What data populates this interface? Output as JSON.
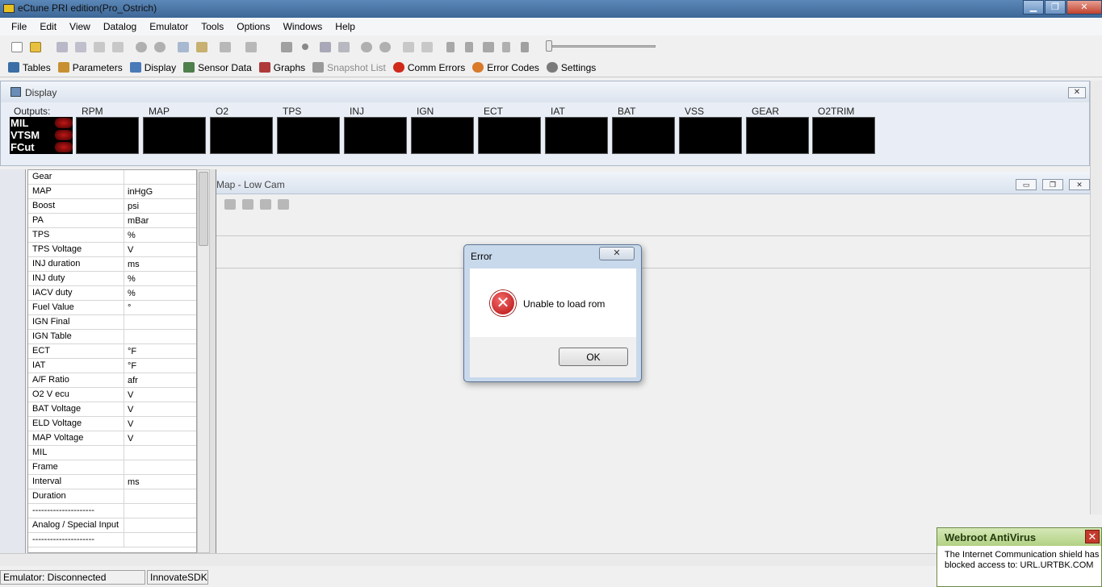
{
  "window": {
    "title": "eCtune PRI edition(Pro_Ostrich)",
    "minimize": "▁",
    "maximize": "❐",
    "close": "✕"
  },
  "menu": [
    "File",
    "Edit",
    "View",
    "Datalog",
    "Emulator",
    "Tools",
    "Options",
    "Windows",
    "Help"
  ],
  "toolbar2": [
    {
      "label": "Tables",
      "icon": "grid-icon",
      "color": "#3a6ea5",
      "disabled": false
    },
    {
      "label": "Parameters",
      "icon": "parameters-icon",
      "color": "#c89030",
      "disabled": false
    },
    {
      "label": "Display",
      "icon": "monitor-icon",
      "color": "#4a7ab8",
      "disabled": false
    },
    {
      "label": "Sensor Data",
      "icon": "sensor-icon",
      "color": "#4f7f4a",
      "disabled": false
    },
    {
      "label": "Graphs",
      "icon": "graph-icon",
      "color": "#b03a3a",
      "disabled": false
    },
    {
      "label": "Snapshot List",
      "icon": "camera-icon",
      "color": "#9a9a9a",
      "disabled": true
    },
    {
      "label": "Comm Errors",
      "icon": "error-circle-icon",
      "color": "#d02a1a",
      "disabled": false
    },
    {
      "label": "Error Codes",
      "icon": "error-codes-icon",
      "color": "#d87a2a",
      "disabled": false
    },
    {
      "label": "Settings",
      "icon": "gear-icon",
      "color": "#7a7a7a",
      "disabled": false
    }
  ],
  "display": {
    "title": "Display",
    "outputs_label": "Outputs:",
    "outputs": [
      "MIL",
      "VTSM",
      "FCut"
    ],
    "gauges": [
      "RPM",
      "MAP",
      "O2",
      "TPS",
      "INJ",
      "IGN",
      "ECT",
      "IAT",
      "BAT",
      "VSS",
      "GEAR",
      "O2TRIM"
    ]
  },
  "sensors": [
    {
      "name": "Gear",
      "unit": ""
    },
    {
      "name": "MAP",
      "unit": "inHgG"
    },
    {
      "name": "Boost",
      "unit": "psi"
    },
    {
      "name": "PA",
      "unit": "mBar"
    },
    {
      "name": "TPS",
      "unit": " %"
    },
    {
      "name": "TPS Voltage",
      "unit": " V"
    },
    {
      "name": "INJ duration",
      "unit": " ms"
    },
    {
      "name": "INJ duty",
      "unit": " %"
    },
    {
      "name": "IACV duty",
      "unit": " %"
    },
    {
      "name": "Fuel Value",
      "unit": " °"
    },
    {
      "name": "IGN Final",
      "unit": ""
    },
    {
      "name": "IGN Table",
      "unit": ""
    },
    {
      "name": "ECT",
      "unit": " °F"
    },
    {
      "name": "IAT",
      "unit": " °F"
    },
    {
      "name": "A/F Ratio",
      "unit": "afr"
    },
    {
      "name": "O2 V ecu",
      "unit": " V"
    },
    {
      "name": "BAT Voltage",
      "unit": " V"
    },
    {
      "name": "ELD Voltage",
      "unit": " V"
    },
    {
      "name": "MAP Voltage",
      "unit": " V"
    },
    {
      "name": "MIL",
      "unit": ""
    },
    {
      "name": "Frame",
      "unit": ""
    },
    {
      "name": "Interval",
      "unit": "ms"
    },
    {
      "name": "Duration",
      "unit": ""
    },
    {
      "name": "---------------------",
      "unit": ""
    },
    {
      "name": "Analog / Special Input",
      "unit": ""
    },
    {
      "name": "---------------------",
      "unit": ""
    }
  ],
  "map_window": {
    "title": "Map - Low Cam",
    "minimize": "▭",
    "restore": "❐",
    "close": "✕"
  },
  "status": {
    "emulator": "Emulator: Disconnected",
    "sdk": "InnovateSDK"
  },
  "dialog": {
    "title": "Error",
    "message": "Unable to load rom",
    "ok": "OK",
    "close": "✕"
  },
  "toast": {
    "title": "Webroot AntiVirus",
    "message": "The Internet Communication shield has blocked access to: URL.URTBK.COM",
    "close": "✕"
  }
}
